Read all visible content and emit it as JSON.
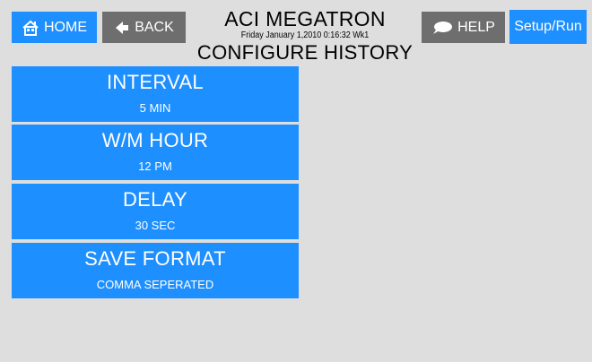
{
  "header": {
    "home_label": "HOME",
    "back_label": "BACK",
    "help_label": "HELP",
    "setup_label": "Setup/Run",
    "app_title": "ACI MEGATRON",
    "datetime": "Friday January 1,2010 0:16:32 Wk1",
    "page_title": "CONFIGURE HISTORY"
  },
  "settings": [
    {
      "label": "INTERVAL",
      "value": "5 MIN"
    },
    {
      "label": "W/M HOUR",
      "value": "12 PM"
    },
    {
      "label": "DELAY",
      "value": "30 SEC"
    },
    {
      "label": "SAVE FORMAT",
      "value": "COMMA SEPERATED"
    }
  ],
  "colors": {
    "background": "#dedede",
    "button_blue": "#1e8fff",
    "button_gray": "#6e6e6e"
  },
  "icons": [
    "house-icon",
    "back-arrow-icon",
    "speech-bubble-icon"
  ]
}
